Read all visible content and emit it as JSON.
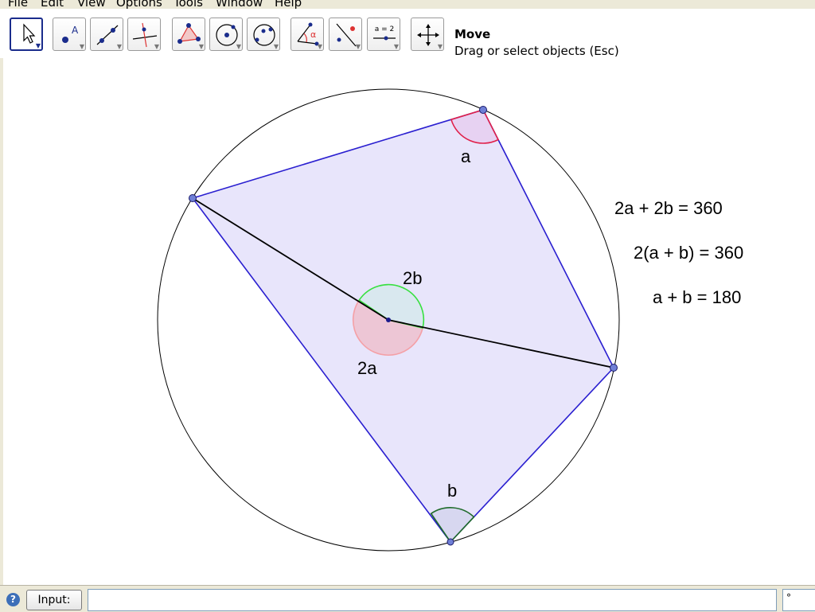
{
  "menu": {
    "items": [
      {
        "label": "File"
      },
      {
        "label": "Edit"
      },
      {
        "label": "View"
      },
      {
        "label": "Options"
      },
      {
        "label": "Tools"
      },
      {
        "label": "Window"
      },
      {
        "label": "Help"
      }
    ]
  },
  "toolbar": {
    "active_tool_name": "Move",
    "active_tool_help": "Drag or select objects (Esc)",
    "tools": [
      {
        "icon": "move-arrow-icon",
        "selected": true
      },
      {
        "icon": "new-point-icon",
        "label": "A"
      },
      {
        "icon": "line-through-two-points-icon"
      },
      {
        "icon": "perpendicular-line-icon"
      },
      {
        "icon": "polygon-icon"
      },
      {
        "icon": "circle-center-point-icon"
      },
      {
        "icon": "circle-three-points-icon"
      },
      {
        "icon": "angle-icon",
        "label": "α"
      },
      {
        "icon": "reflect-about-line-icon"
      },
      {
        "icon": "slider-icon",
        "label": "a = 2"
      },
      {
        "icon": "move-graphics-view-icon"
      }
    ]
  },
  "drawing": {
    "colors": {
      "circle": "#000000",
      "polygon_fill": "#e6e2fb",
      "polygon_edge": "#2a1fd0",
      "radius_segment": "#000000",
      "point_fill": "#6f7fd6",
      "center_point": "#1a1a8c",
      "angle_a": "#e0204a",
      "angle_b": "#1f6b2a",
      "angle_2b": "#38e040",
      "angle_2a": "#f4a0a6"
    },
    "labels": {
      "angle_a": "a",
      "angle_b": "b",
      "angle_2b": "2b",
      "angle_2a": "2a"
    },
    "equations": [
      "2a + 2b = 360",
      "2(a + b) = 360",
      "a + b = 180"
    ]
  },
  "input_bar": {
    "button_label": "Input:",
    "value": "",
    "symbol": "°"
  }
}
